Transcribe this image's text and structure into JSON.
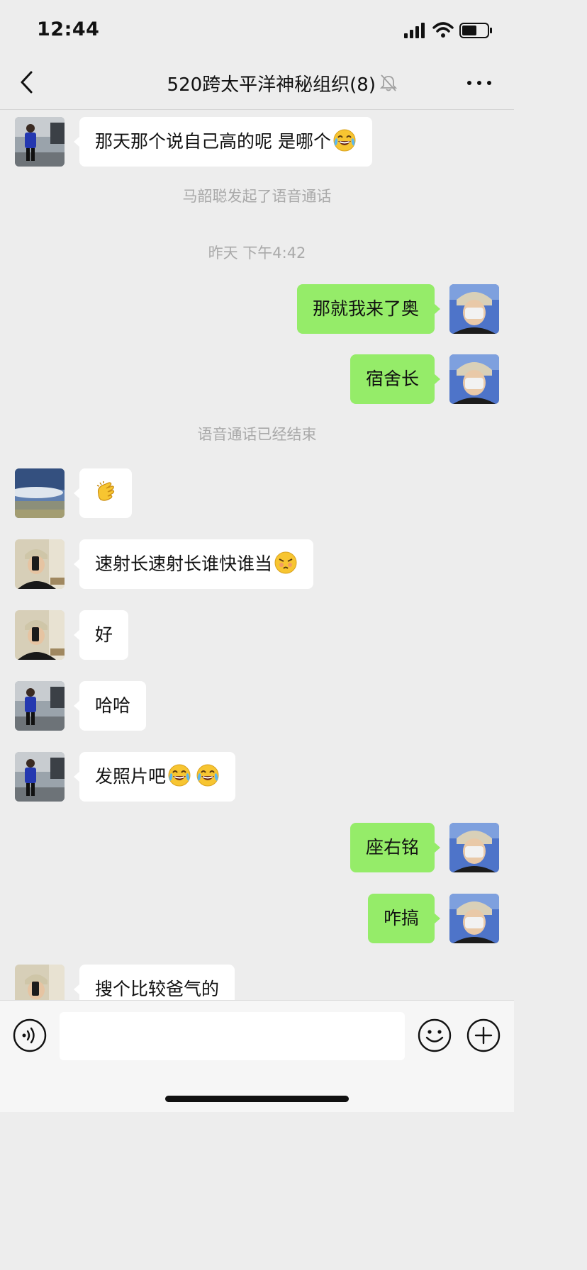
{
  "status_bar": {
    "time": "12:44"
  },
  "header": {
    "title": "520跨太平洋神秘组织(8)"
  },
  "messages": [
    {
      "type": "in",
      "text": "那天那个说自己高的呢  是哪个",
      "emoji": "laugh-cry"
    },
    {
      "type": "system",
      "text": "马韶聪发起了语音通话"
    },
    {
      "type": "system",
      "text": "昨天 下午4:42"
    },
    {
      "type": "out",
      "text": "那就我来了奥"
    },
    {
      "type": "out",
      "text": "宿舍长"
    },
    {
      "type": "system",
      "text": "语音通话已经结束"
    },
    {
      "type": "in",
      "text": "",
      "emoji": "clapping-hands"
    },
    {
      "type": "in",
      "text": "速射长速射长谁快谁当",
      "emoji": "sleepy-face"
    },
    {
      "type": "in",
      "text": "好"
    },
    {
      "type": "in",
      "text": "哈哈"
    },
    {
      "type": "in",
      "text": "发照片吧",
      "emoji": "laugh-cry x2"
    },
    {
      "type": "out",
      "text": "座右铭"
    },
    {
      "type": "out",
      "text": "咋搞"
    },
    {
      "type": "in",
      "text": "搜个比较爸气的"
    }
  ],
  "input": {
    "placeholder": ""
  },
  "colors": {
    "background": "#ededed",
    "outgoing_bubble": "#95ec69",
    "incoming_bubble": "#ffffff",
    "system_text": "#a9a9a9"
  }
}
